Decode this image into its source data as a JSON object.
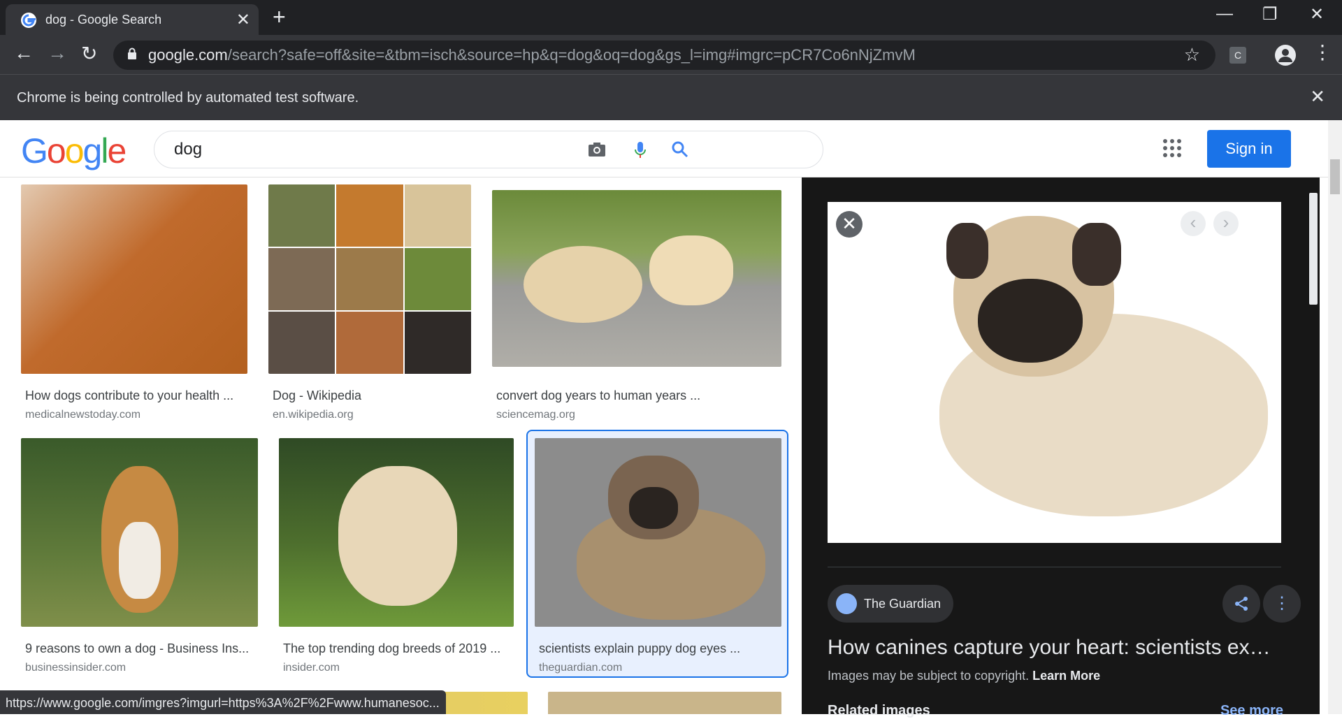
{
  "browser": {
    "tab_title": "dog - Google Search",
    "tab_close": "✕",
    "new_tab": "+",
    "url_host": "google.com",
    "url_path": "/search?safe=off&site=&tbm=isch&source=hp&q=dog&oq=dog&gs_l=img#imgrc=pCR7Co6nNjZmvM",
    "extension_label": "C",
    "infobar_text": "Chrome is being controlled by automated test software.",
    "status_url": "https://www.google.com/imgres?imgurl=https%3A%2F%2Fwww.humanesoc..."
  },
  "header": {
    "search_value": "dog",
    "signin_label": "Sign in"
  },
  "results": [
    {
      "caption": "How dogs contribute to your health ...",
      "source": "medicalnewstoday.com",
      "colors": [
        "#c06a2c",
        "#e3c9b0"
      ]
    },
    {
      "caption": "Dog - Wikipedia",
      "source": "en.wikipedia.org",
      "colors": [
        "#8d6c3d",
        "#5d7040"
      ]
    },
    {
      "caption": "convert dog years to human years ...",
      "source": "sciencemag.org",
      "colors": [
        "#9aa393",
        "#d9c8a8"
      ]
    },
    {
      "caption": "9 reasons to own a dog - Business Ins...",
      "source": "businessinsider.com",
      "colors": [
        "#5f7a3a",
        "#c68a43"
      ]
    },
    {
      "caption": "The top trending dog breeds of 2019 ...",
      "source": "insider.com",
      "colors": [
        "#4d6e2d",
        "#e8d7b8"
      ]
    },
    {
      "caption": "scientists explain puppy dog eyes ...",
      "source": "theguardian.com",
      "colors": [
        "#8c8c8c",
        "#a8906e"
      ]
    }
  ],
  "panel": {
    "source_name": "The Guardian",
    "title": "How canines capture your heart: scientists explain puppy dog eyes",
    "copyright": "Images may be subject to copyright.",
    "learn_more": "Learn More",
    "related": "Related images",
    "see_more": "See more"
  }
}
